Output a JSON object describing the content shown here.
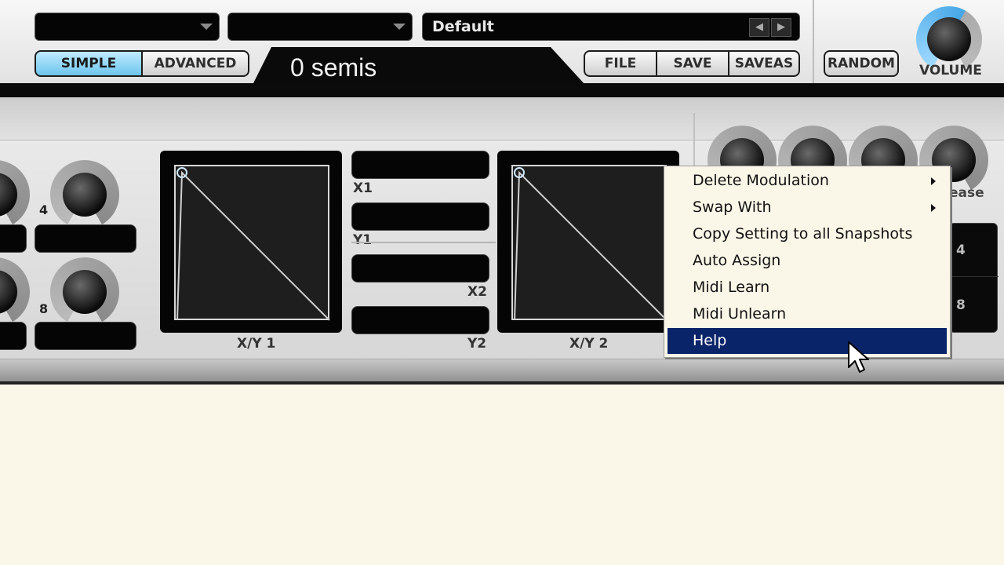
{
  "header": {
    "preset_name": "Default",
    "mode_simple": "SIMPLE",
    "mode_advanced": "ADVANCED",
    "mode_active": "SIMPLE",
    "semis_display": "0 semis",
    "file_label": "FILE",
    "save_label": "SAVE",
    "saveas_label": "SAVEAS",
    "random_label": "RANDOM",
    "volume_label": "VOLUME",
    "prev_icon": "chevron-left-icon",
    "next_icon": "chevron-right-icon",
    "accent_color": "#6dc5ee"
  },
  "panel": {
    "knob_labels": [
      "4",
      "8"
    ],
    "xy_pad_1_label": "X/Y 1",
    "xy_pad_2_label": "X/Y 2",
    "slot_labels": [
      "X1",
      "Y1",
      "X2",
      "Y2"
    ],
    "release_label_partial": "ease",
    "right_box_cells": [
      "4",
      "8"
    ]
  },
  "context_menu": {
    "items": [
      {
        "label": "Delete Modulation",
        "submenu": true
      },
      {
        "label": "Swap With",
        "submenu": true
      },
      {
        "label": "Copy Setting to all Snapshots",
        "submenu": false
      },
      {
        "label": "Auto Assign",
        "submenu": false
      },
      {
        "label": "Midi Learn",
        "submenu": false
      },
      {
        "label": "Midi Unlearn",
        "submenu": false
      },
      {
        "label": "Help",
        "submenu": false,
        "highlighted": true
      }
    ],
    "highlight_color": "#0a246a"
  }
}
